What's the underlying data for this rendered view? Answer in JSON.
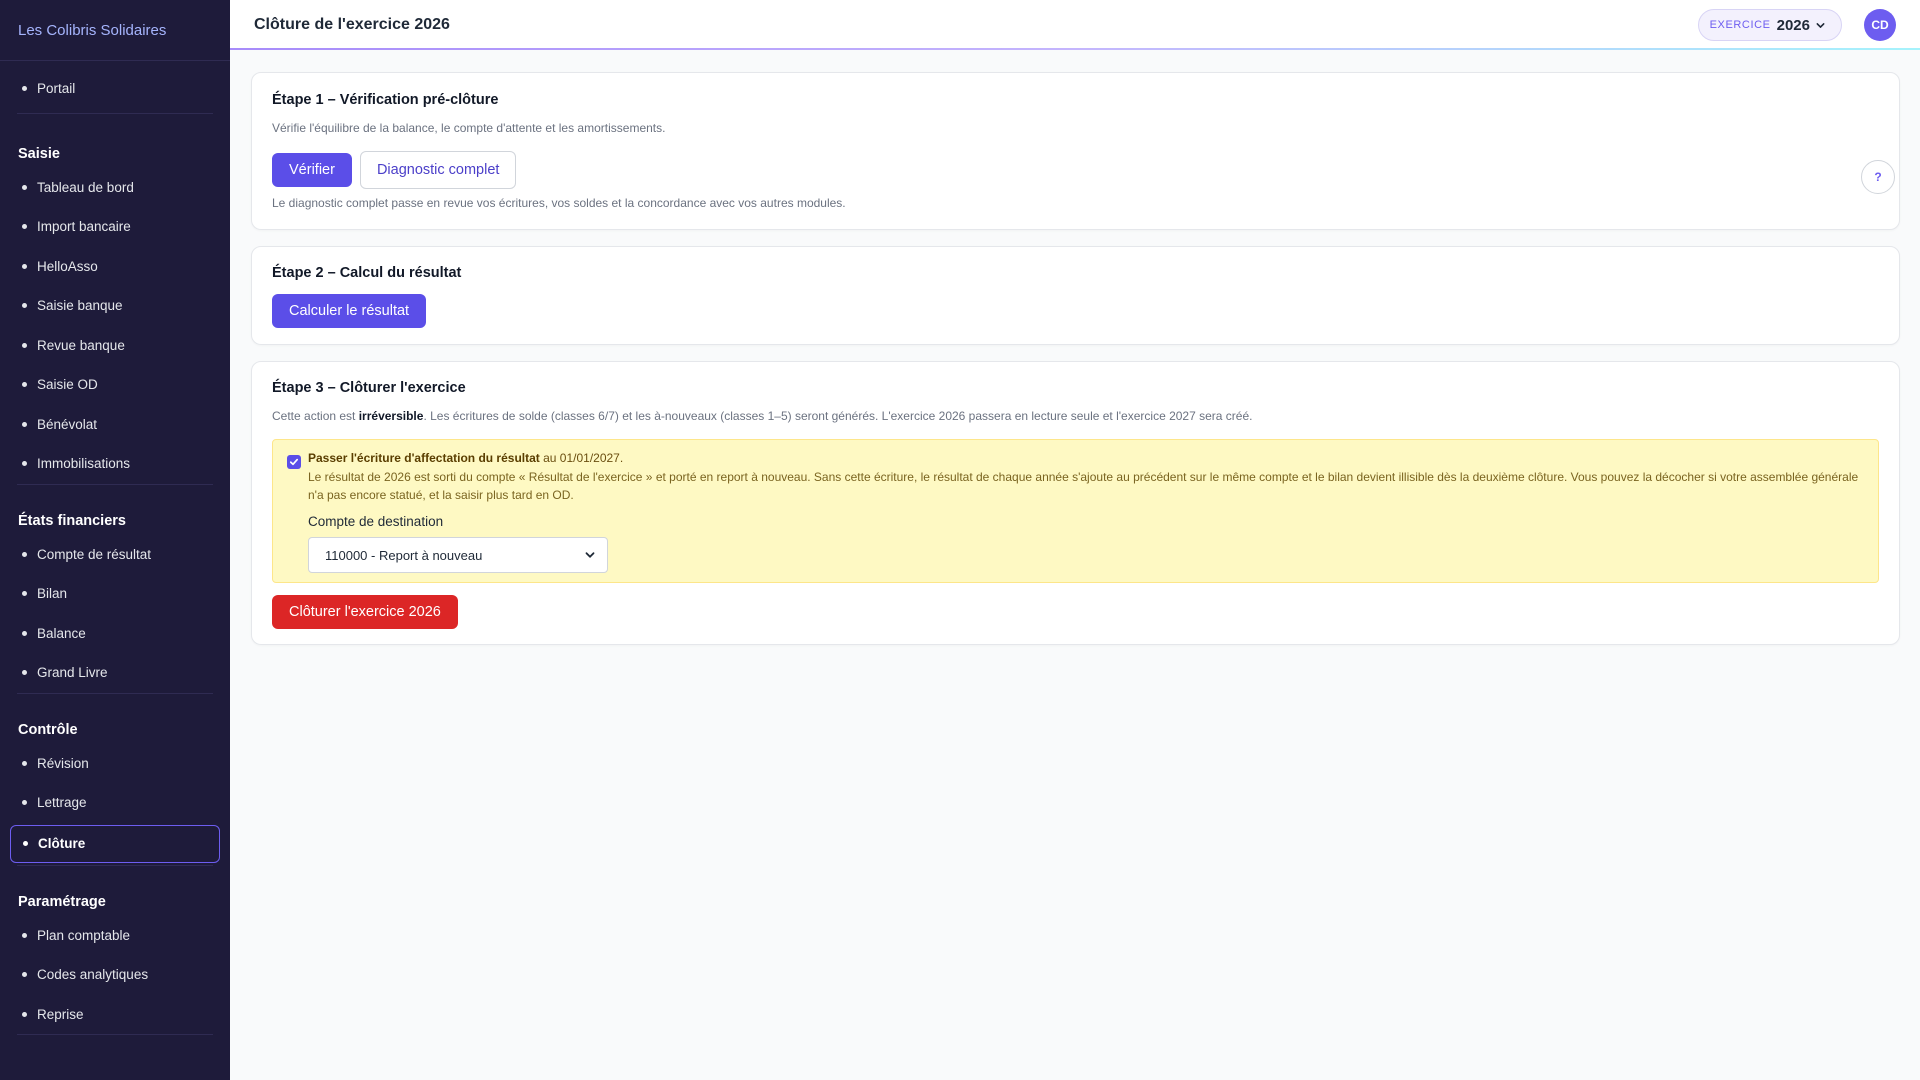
{
  "app": {
    "brand": "Les Colibris Solidaires"
  },
  "header": {
    "title": "Clôture de l'exercice 2026",
    "year_label": "EXERCICE",
    "year_value": "2026",
    "avatar": "CD"
  },
  "sidebar": {
    "top": [
      {
        "label": "Portail"
      }
    ],
    "groups": [
      {
        "title": "Saisie",
        "items": [
          "Tableau de bord",
          "Import bancaire",
          "HelloAsso",
          "Saisie banque",
          "Revue banque",
          "Saisie OD",
          "Bénévolat",
          "Immobilisations"
        ]
      },
      {
        "title": "États financiers",
        "items": [
          "Compte de résultat",
          "Bilan",
          "Balance",
          "Grand Livre"
        ]
      },
      {
        "title": "Contrôle",
        "items": [
          "Révision",
          "Lettrage",
          "Clôture"
        ]
      },
      {
        "title": "Paramétrage",
        "items": [
          "Plan comptable",
          "Codes analytiques",
          "Reprise"
        ]
      }
    ],
    "active": "Clôture"
  },
  "step1": {
    "title": "Étape 1 – Vérification pré-clôture",
    "subtitle": "Vérifie l'équilibre de la balance, le compte d'attente et les amortissements.",
    "verify_button": "Vérifier",
    "diagnostic_button": "Diagnostic complet",
    "note": "Le diagnostic complet passe en revue vos écritures, vos soldes et la concordance avec vos autres modules.",
    "help": "?"
  },
  "step2": {
    "title": "Étape 2 – Calcul du résultat",
    "button": "Calculer le résultat"
  },
  "step3": {
    "title": "Étape 3 – Clôturer l'exercice",
    "text_before": "Cette action est ",
    "text_bold": "irréversible",
    "text_after": ". Les écritures de solde (classes 6/7) et les à-nouveaux (classes 1–5) seront générés. L'exercice 2026 passera en lecture seule et l'exercice 2027 sera créé.",
    "checkbox_checked": true,
    "checkbox_bold": "Passer l'écriture d'affectation du résultat",
    "checkbox_rest": " au 01/01/2027.",
    "warning": "Le résultat de 2026 est sorti du compte « Résultat de l'exercice » et porté en report à nouveau. Sans cette écriture, le résultat de chaque année s'ajoute au précédent sur le même compte et le bilan devient illisible dès la deuxième clôture. Vous pouvez la décocher si votre assemblée générale n'a pas encore statué, et la saisir plus tard en OD.",
    "dest_label": "Compte de destination",
    "dest_value": "110000 - Report à nouveau",
    "close_button": "Clôturer l'exercice 2026"
  }
}
